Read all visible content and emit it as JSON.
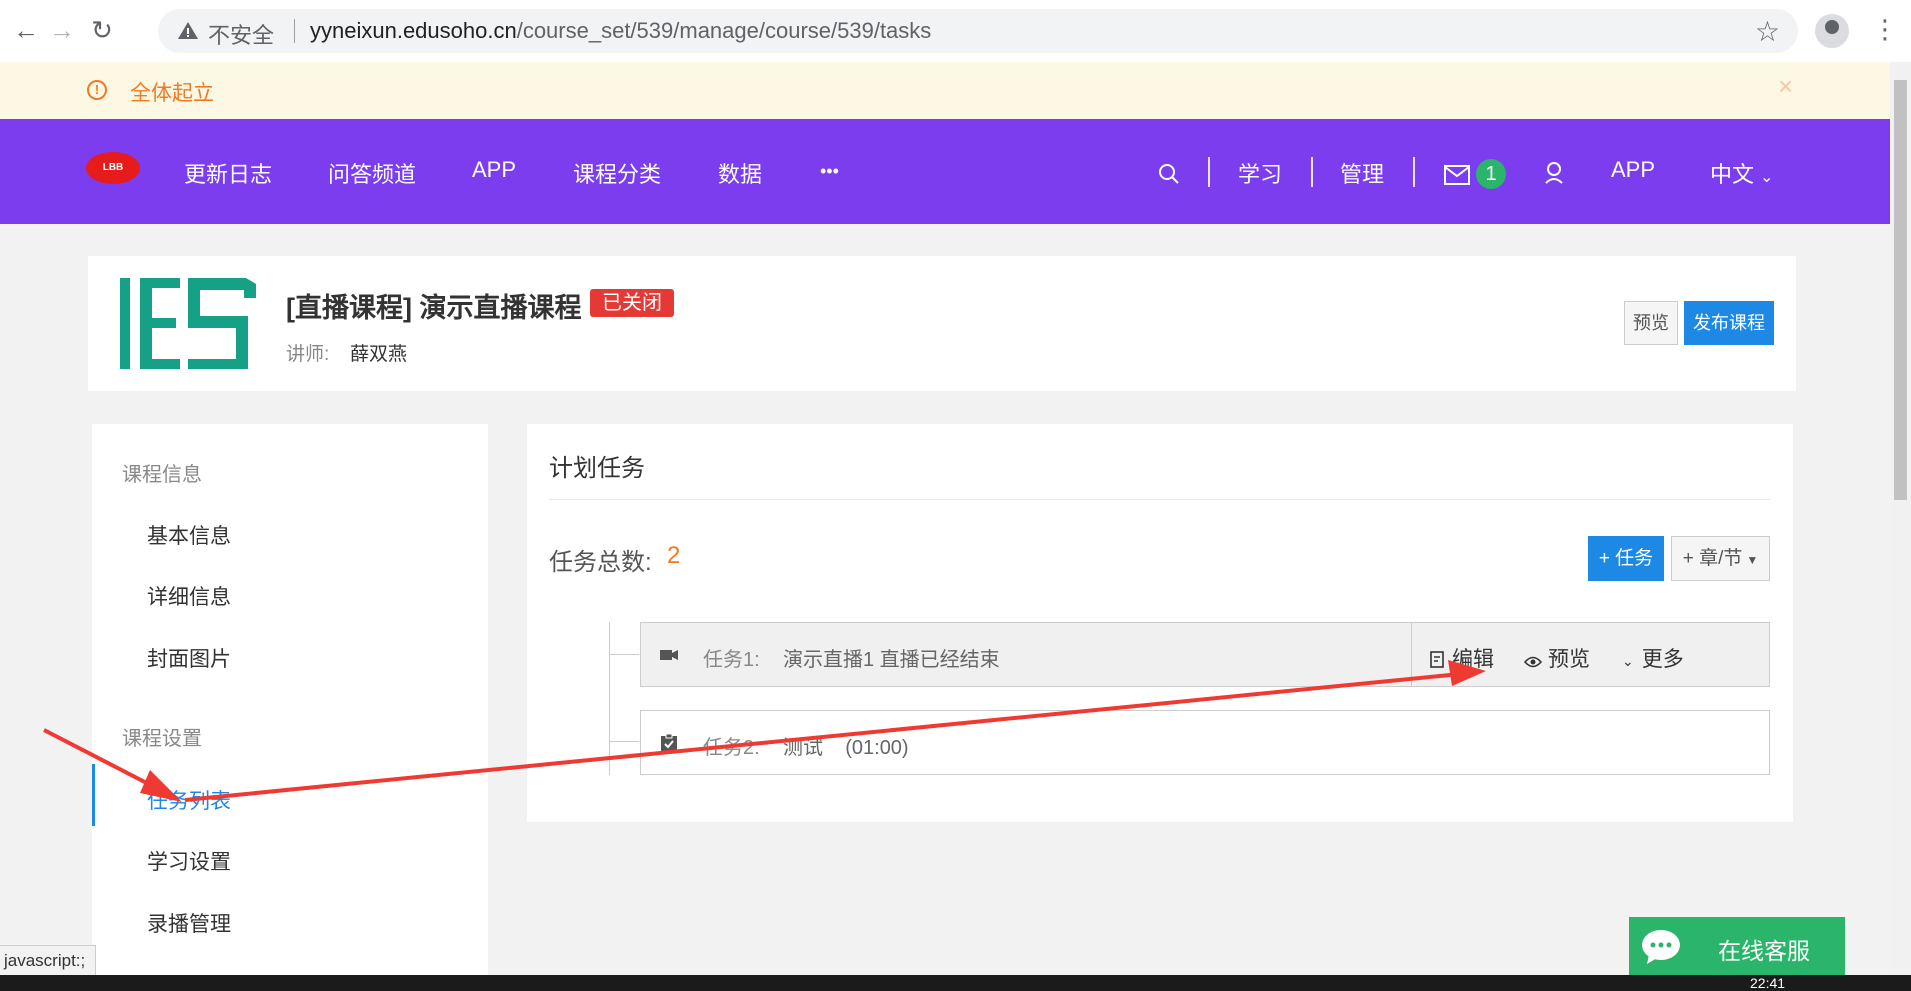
{
  "browser": {
    "insecure_label": "不安全",
    "url_host": "yyneixun.edusoho.cn",
    "url_path": "/course_set/539/manage/course/539/tasks"
  },
  "notice": {
    "text": "全体起立"
  },
  "topnav": {
    "logo_text": "LBB",
    "items": [
      "更新日志",
      "问答频道",
      "APP",
      "课程分类",
      "数据",
      "•••"
    ],
    "right": {
      "study": "学习",
      "manage": "管理",
      "message_count": "1",
      "app": "APP",
      "language": "中文"
    }
  },
  "course": {
    "title": "[直播课程] 演示直播课程",
    "status_tag": "已关闭",
    "teacher_label": "讲师:",
    "teacher_name": "薛双燕",
    "preview_button": "预览",
    "publish_button": "发布课程"
  },
  "sidebar": {
    "group_info": "课程信息",
    "info_items": [
      "基本信息",
      "详细信息",
      "封面图片"
    ],
    "group_settings": "课程设置",
    "settings_items": [
      "任务列表",
      "学习设置",
      "录播管理"
    ]
  },
  "main": {
    "title": "计划任务",
    "count_label": "任务总数:",
    "count_value": "2",
    "add_task_button": "+ 任务",
    "add_chapter_button": "+ 章/节",
    "tasks": [
      {
        "label": "任务1:",
        "name": "演示直播1 直播已经结束",
        "icon": "video-icon"
      },
      {
        "label": "任务2:",
        "name": "测试    (01:00)",
        "icon": "checklist-icon"
      }
    ],
    "actions": {
      "edit": "编辑",
      "preview": "预览",
      "more": "更多"
    }
  },
  "chat": {
    "label": "在线客服"
  },
  "statusbar": {
    "text": "javascript:;"
  },
  "taskbar": {
    "clock": "22:41"
  },
  "colors": {
    "nav_purple": "#7b3ded",
    "primary_blue": "#1e88e5",
    "notice_orange": "#f07a24",
    "closed_red": "#e53935",
    "chat_green": "#2ab56a",
    "annotation_red": "#ee3a32"
  }
}
